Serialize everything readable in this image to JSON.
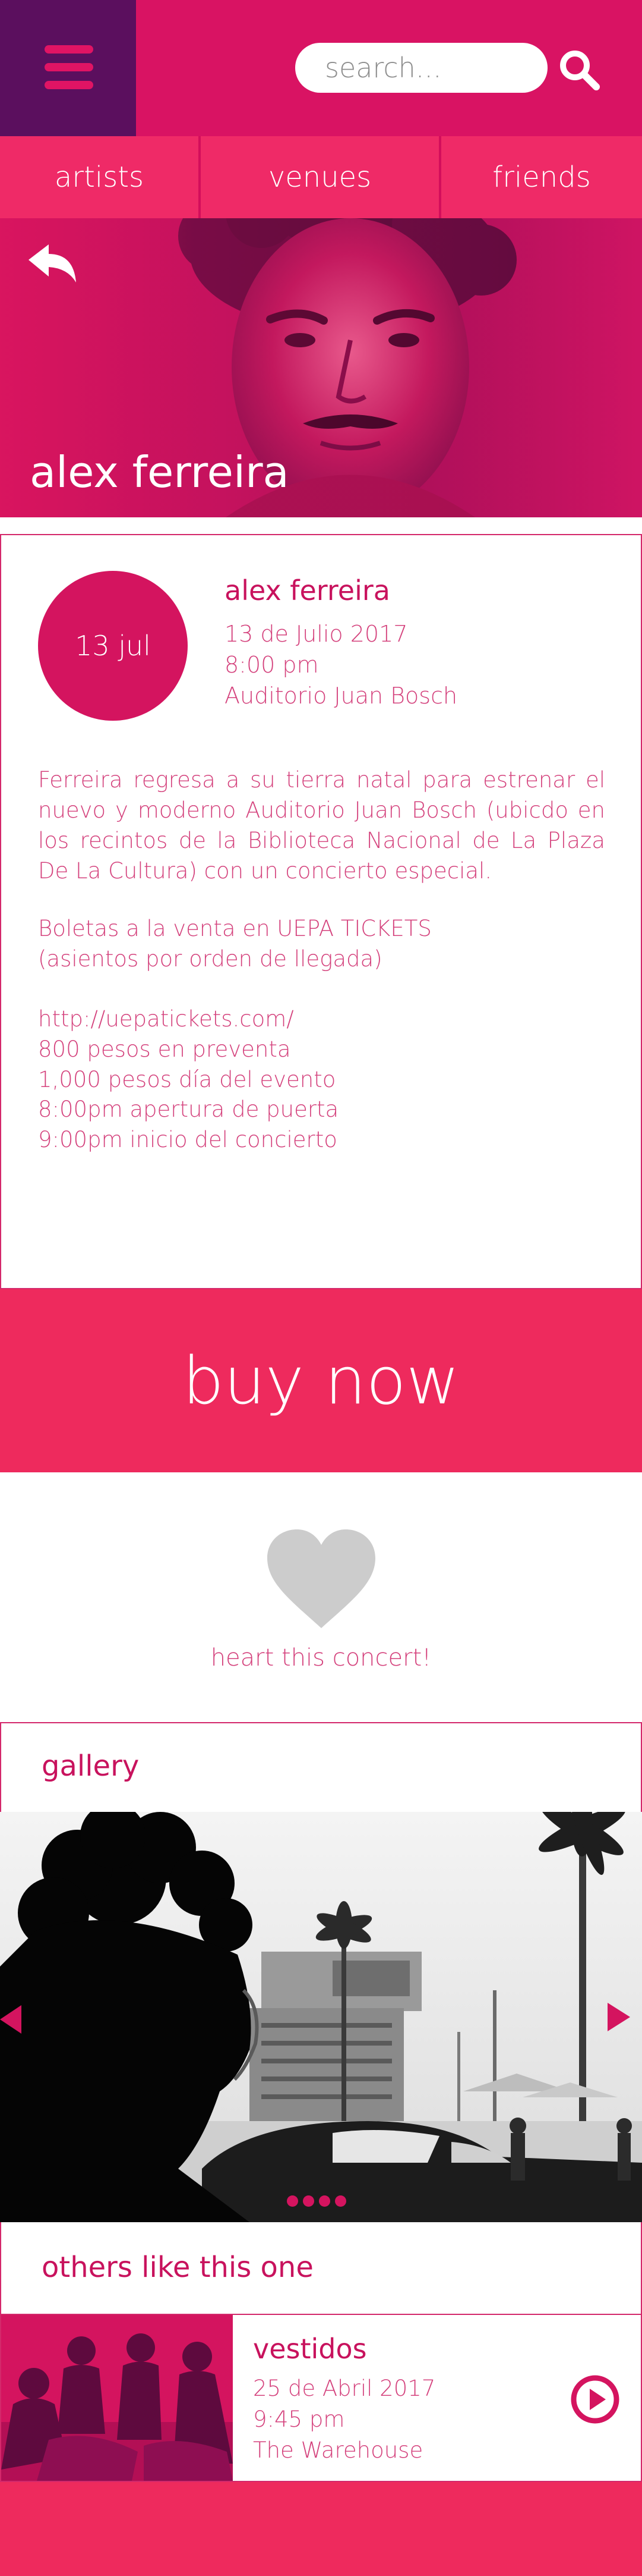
{
  "colors": {
    "brand_magenta": "#d91363",
    "menu_purple": "#5b0f5e",
    "tab_pink": "#ef2a67",
    "buy_now_pink": "#ee2a5d",
    "text_pink": "#d4417c",
    "heart_gray": "#cccccc"
  },
  "header": {
    "menu_icon": "hamburger-icon",
    "search": {
      "placeholder": "search...",
      "value": "",
      "icon": "search-icon"
    }
  },
  "tabs": [
    {
      "label": "artists"
    },
    {
      "label": "venues"
    },
    {
      "label": "friends"
    }
  ],
  "hero": {
    "back_icon": "back-arrow-icon",
    "title": "alex ferreira"
  },
  "event": {
    "date_badge": "13 jul",
    "name": "alex ferreira",
    "date": "13 de Julio 2017",
    "time": "8:00 pm",
    "venue": "Auditorio Juan Bosch",
    "description": "Ferreira regresa a su tierra natal para estrenar el nuevo y moderno Auditorio Juan Bosch (ubicdo en los recintos de la Biblioteca Nacional de La Plaza De La Cultura) con un concierto especial.",
    "tickets_line1": "Boletas a la venta en UEPA TICKETS",
    "tickets_line2": "(asientos por orden de llegada)",
    "tickets_url": "http://uepatickets.com/",
    "price_presale": "800 pesos en preventa",
    "price_day": "1,000 pesos día del evento",
    "doors_open": "8:00pm apertura de puerta",
    "show_start": "9:00pm inicio del concierto"
  },
  "buy_now": {
    "label": "buy now"
  },
  "heart": {
    "icon": "heart-icon",
    "label": "heart this concert!"
  },
  "gallery": {
    "title": "gallery",
    "prev_icon": "chevron-left-icon",
    "next_icon": "chevron-right-icon",
    "dots": 4,
    "active_dot": 1
  },
  "others": {
    "title": "others like this one",
    "items": [
      {
        "name": "vestidos",
        "date": "25 de Abril 2017",
        "time": "9:45 pm",
        "venue": "The Warehouse",
        "icon": "play-circle-icon"
      }
    ]
  }
}
